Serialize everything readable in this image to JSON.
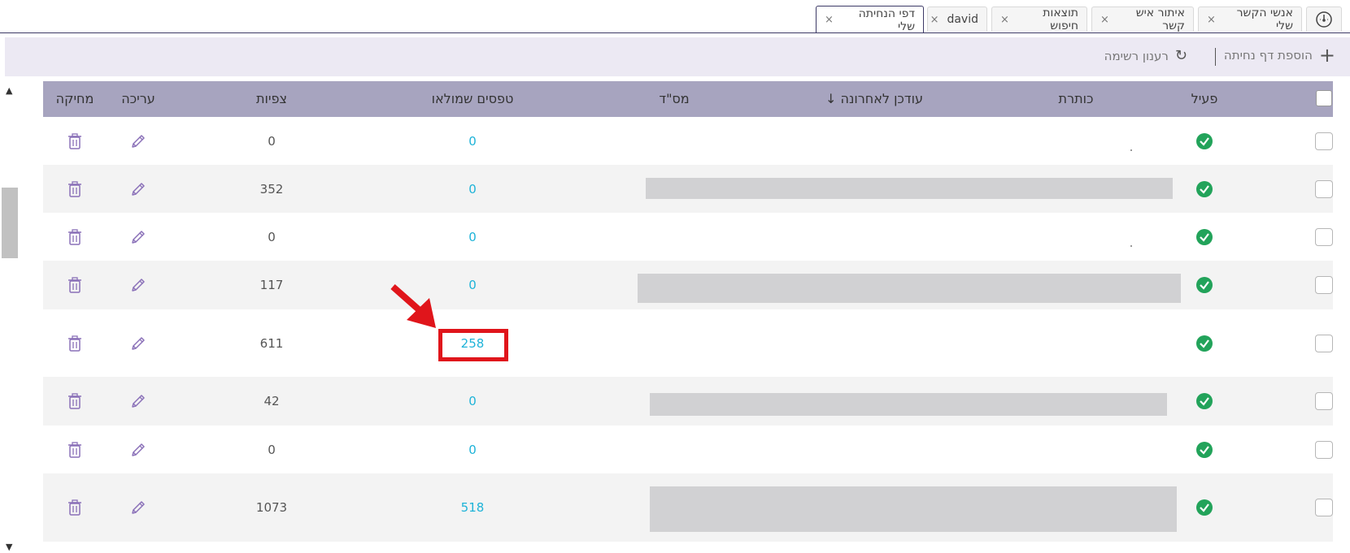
{
  "tabs": [
    {
      "label": "אנשי הקשר שלי",
      "active": false
    },
    {
      "label": "איתור איש קשר",
      "active": false
    },
    {
      "label": "תוצאות חיפוש",
      "active": false
    },
    {
      "label": "david",
      "active": false
    },
    {
      "label": "דפי הנחיתה שלי",
      "active": true
    }
  ],
  "tab_close": "×",
  "toolbar": {
    "add_label": "הוספת דף נחיתה",
    "add_icon": "+",
    "refresh_label": "רענון רשימה",
    "refresh_icon": "↻"
  },
  "table": {
    "headers": {
      "active": "פעיל",
      "title": "כותרת",
      "updated": "עודכן לאחרונה ↓",
      "id": "מס\"ד",
      "forms": "טפסים שמולאו",
      "views": "צפיות",
      "edit": "עריכה",
      "delete": "מחיקה"
    },
    "rows": [
      {
        "views": "0",
        "forms": "0",
        "active": true
      },
      {
        "views": "352",
        "forms": "0",
        "active": true
      },
      {
        "views": "0",
        "forms": "0",
        "active": true
      },
      {
        "views": "117",
        "forms": "0",
        "active": true
      },
      {
        "views": "611",
        "forms": "258",
        "active": true,
        "highlighted": true
      },
      {
        "views": "42",
        "forms": "0",
        "active": true
      },
      {
        "views": "0",
        "forms": "0",
        "active": true
      },
      {
        "views": "1073",
        "forms": "518",
        "active": true
      }
    ]
  },
  "colors": {
    "accent": "#3d3a66",
    "header_bg": "#a7a4bf",
    "toolbar_bg": "#ece9f3",
    "link": "#1eb3d8",
    "active_check": "#22a35a",
    "icon_purple": "#8a70b8",
    "highlight": "#e0151b"
  },
  "icons": {
    "dashboard": "dashboard-gauge-icon",
    "delete": "trash-icon",
    "edit": "pencil-icon",
    "active": "check-circle-icon",
    "refresh": "refresh-icon",
    "add": "plus-icon"
  }
}
